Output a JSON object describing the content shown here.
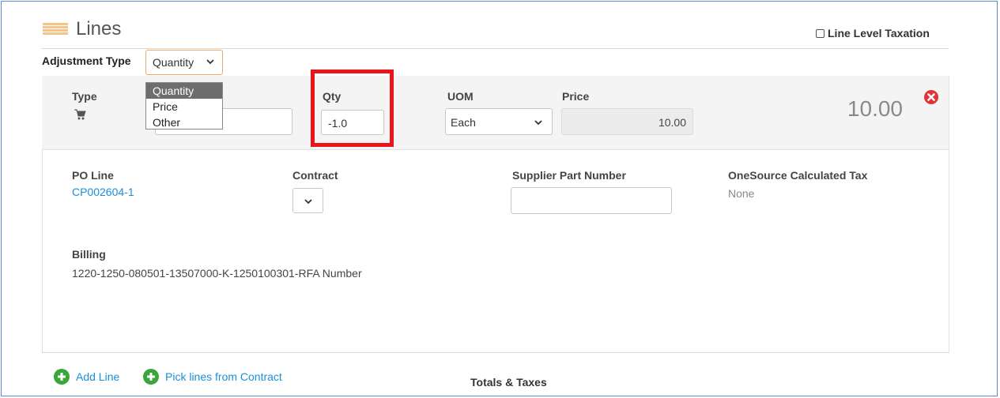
{
  "header": {
    "title": "Lines",
    "line_level_taxation": "Line Level Taxation"
  },
  "adjustment": {
    "label": "Adjustment Type",
    "selected": "Quantity",
    "options": [
      "Quantity",
      "Price",
      "Other"
    ]
  },
  "line": {
    "type_label": "Type",
    "qty_label": "Qty",
    "qty_value": "-1.0",
    "uom_label": "UOM",
    "uom_value": "Each",
    "price_label": "Price",
    "price_value": "10.00",
    "total": "10.00"
  },
  "details": {
    "po_line_label": "PO Line",
    "po_line_value": "CP002604-1",
    "contract_label": "Contract",
    "supplier_part_label": "Supplier Part Number",
    "onesource_label": "OneSource Calculated Tax",
    "onesource_value": "None",
    "billing_label": "Billing",
    "billing_value": "1220-1250-080501-13507000-K-1250100301-RFA Number"
  },
  "footer": {
    "add_line": "Add Line",
    "pick_lines": "Pick lines from Contract",
    "totals_taxes": "Totals & Taxes"
  },
  "colors": {
    "link": "#1a8fd6",
    "highlight": "#e8161b",
    "remove": "#e0333a",
    "add": "#3aa63a",
    "lines_icon": "#f4c48a"
  }
}
